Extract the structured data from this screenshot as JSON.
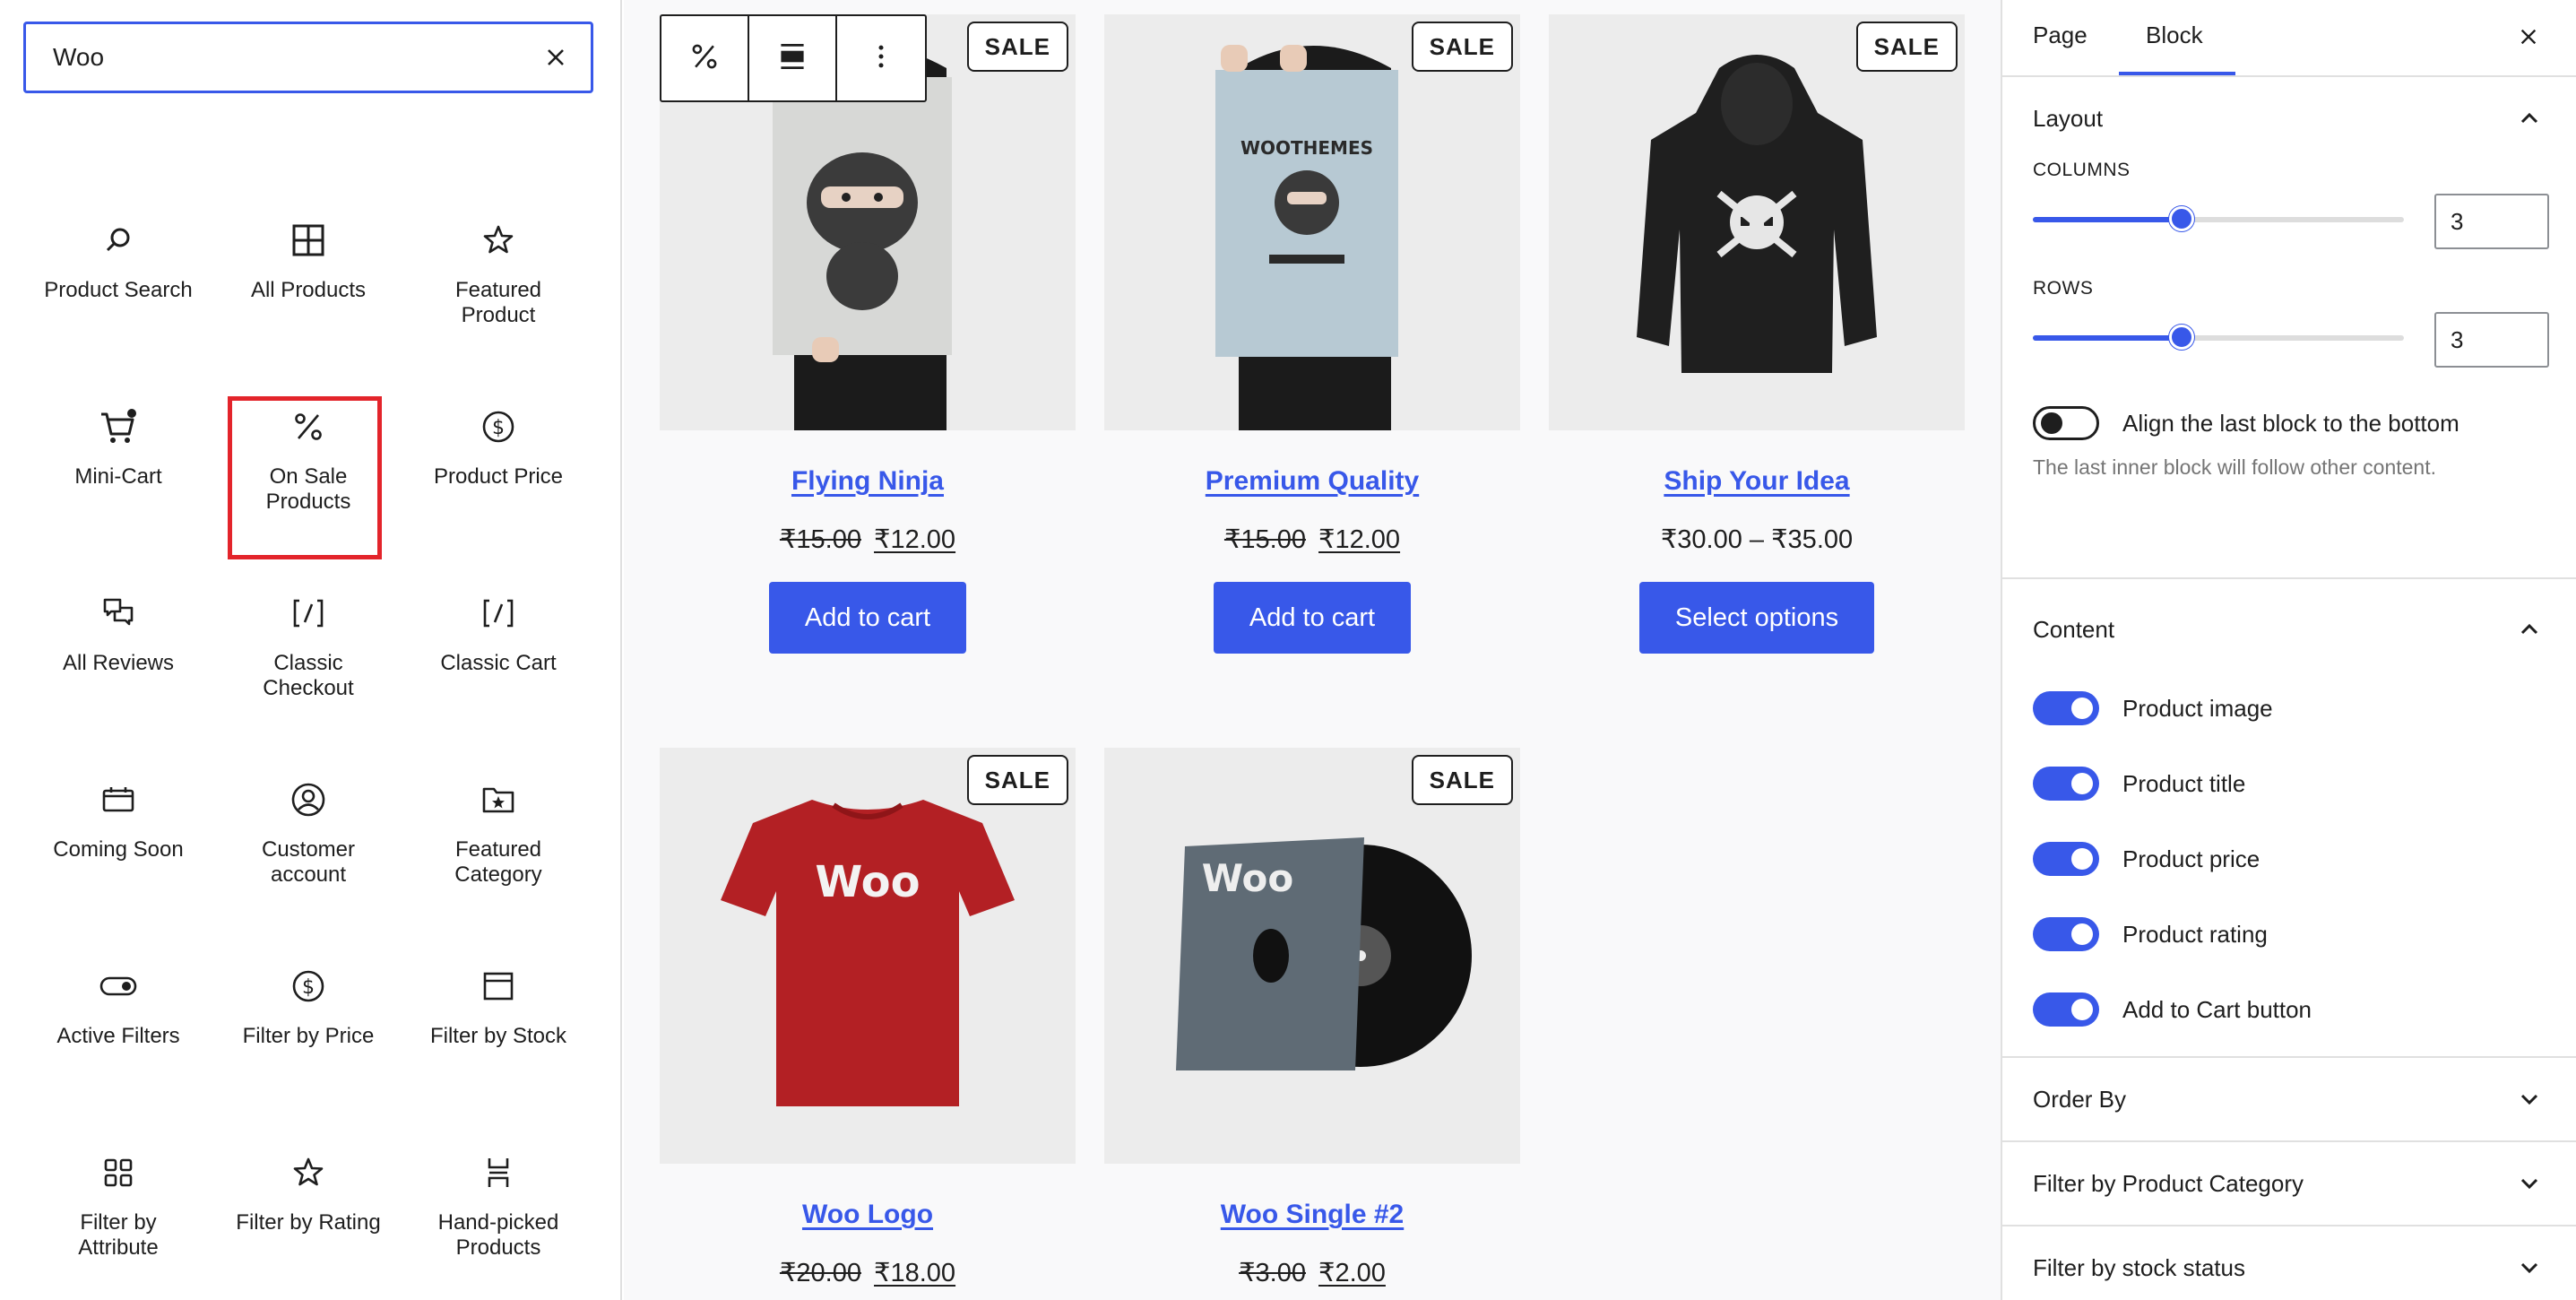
{
  "inserter": {
    "search_value": "Woo",
    "blocks": [
      {
        "label": "Product Search",
        "icon": "search-icon"
      },
      {
        "label": "All Products",
        "icon": "grid-icon"
      },
      {
        "label": "Featured Product",
        "icon": "star-icon"
      },
      {
        "label": "Mini-Cart",
        "icon": "cart-icon"
      },
      {
        "label": "On Sale Products",
        "icon": "percent-icon"
      },
      {
        "label": "Product Price",
        "icon": "dollar-circle-icon"
      },
      {
        "label": "All Reviews",
        "icon": "comments-icon"
      },
      {
        "label": "Classic Checkout",
        "icon": "shortcode-icon"
      },
      {
        "label": "Classic Cart",
        "icon": "shortcode-icon"
      },
      {
        "label": "Coming Soon",
        "icon": "calendar-icon"
      },
      {
        "label": "Customer account",
        "icon": "user-circle-icon"
      },
      {
        "label": "Featured Category",
        "icon": "folder-star-icon"
      },
      {
        "label": "Active Filters",
        "icon": "toggle-icon"
      },
      {
        "label": "Filter by Price",
        "icon": "dollar-circle-icon"
      },
      {
        "label": "Filter by Stock",
        "icon": "archive-icon"
      },
      {
        "label": "Filter by Attribute",
        "icon": "category-grid-icon"
      },
      {
        "label": "Filter by Rating",
        "icon": "star-icon"
      },
      {
        "label": "Hand-picked Products",
        "icon": "hand-picked-icon"
      }
    ]
  },
  "products": [
    {
      "title": "Flying Ninja",
      "old_price": "₹15.00",
      "new_price": "₹12.00",
      "price_range": "",
      "button": "Add to cart",
      "badge": "SALE",
      "image": "ninja-poster"
    },
    {
      "title": "Premium Quality",
      "old_price": "₹15.00",
      "new_price": "₹12.00",
      "price_range": "",
      "button": "Add to cart",
      "badge": "SALE",
      "image": "woothemes-poster"
    },
    {
      "title": "Ship Your Idea",
      "old_price": "",
      "new_price": "",
      "price_range": "₹30.00 – ₹35.00",
      "button": "Select options",
      "badge": "SALE",
      "image": "hoodie"
    },
    {
      "title": "Woo Logo",
      "old_price": "₹20.00",
      "new_price": "₹18.00",
      "price_range": "",
      "button": "",
      "badge": "SALE",
      "image": "tshirt"
    },
    {
      "title": "Woo Single #2",
      "old_price": "₹3.00",
      "new_price": "₹2.00",
      "price_range": "",
      "button": "",
      "badge": "SALE",
      "image": "vinyl"
    }
  ],
  "images": {
    "tshirt_text": "Woo",
    "vinyl_text": "Woo",
    "poster_text": "WOOTHEMES"
  },
  "settings": {
    "tabs": [
      "Page",
      "Block"
    ],
    "active_tab": "Block",
    "layout": {
      "title": "Layout",
      "columns_label": "COLUMNS",
      "columns_value": "3",
      "columns_fraction": 0.4,
      "rows_label": "ROWS",
      "rows_value": "3",
      "rows_fraction": 0.4,
      "align_label": "Align the last block to the bottom",
      "align_on": false,
      "align_help": "The last inner block will follow other content."
    },
    "content": {
      "title": "Content",
      "toggles": [
        {
          "label": "Product image",
          "on": true
        },
        {
          "label": "Product title",
          "on": true
        },
        {
          "label": "Product price",
          "on": true
        },
        {
          "label": "Product rating",
          "on": true
        },
        {
          "label": "Add to Cart button",
          "on": true
        }
      ]
    },
    "collapsed_sections": [
      "Order By",
      "Filter by Product Category",
      "Filter by stock status"
    ]
  },
  "colors": {
    "accent": "#3858e9",
    "highlight": "#e3242b"
  }
}
